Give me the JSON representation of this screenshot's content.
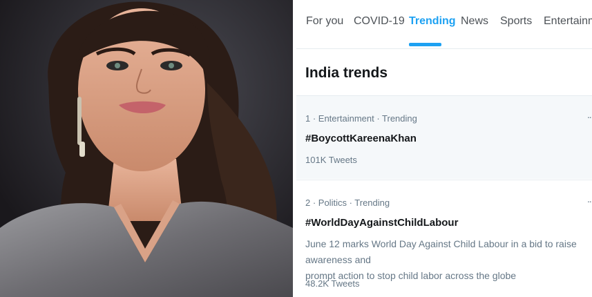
{
  "tabs": [
    {
      "label": "For you"
    },
    {
      "label": "COVID-19"
    },
    {
      "label": "Trending"
    },
    {
      "label": "News"
    },
    {
      "label": "Sports"
    },
    {
      "label": "Entertainmen"
    }
  ],
  "active_tab": "Trending",
  "section_title": "India trends",
  "trends": [
    {
      "meta": "1 · Entertainment · Trending",
      "name": "#BoycottKareenaKhan",
      "description": "",
      "count": "101K Tweets"
    },
    {
      "meta": "2 · Politics · Trending",
      "name": "#WorldDayAgainstChildLabour",
      "description_line1": "June 12 marks World Day Against Child Labour in a bid to raise awareness and",
      "description_line2": "prompt action to stop child labor across the globe",
      "count": "48.2K Tweets"
    }
  ],
  "colors": {
    "accent": "#1da1f2",
    "text_primary": "#14171a",
    "text_secondary": "#657786"
  },
  "icons": {
    "more": "more-icon"
  }
}
